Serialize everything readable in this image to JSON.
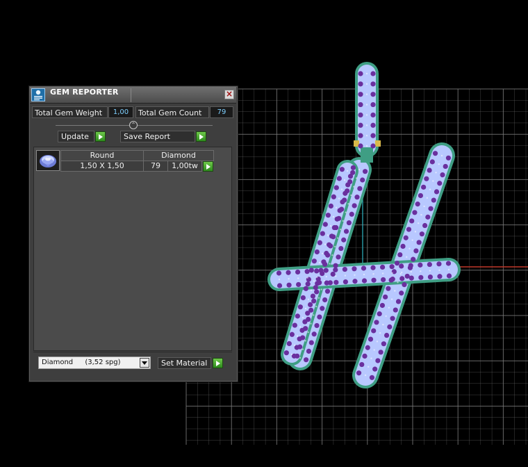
{
  "gem_reporter": {
    "title": "GEM REPORTER",
    "close_glyph": "×",
    "total_weight_label": "Total Gem Weight",
    "total_weight_value": "1,00",
    "total_count_label": "Total Gem Count",
    "total_count_value": "79",
    "slider_glyph": "⌃",
    "update_label": "Update",
    "save_report_label": "Save Report",
    "gem_table": {
      "headers": [
        "Round",
        "Diamond"
      ],
      "rows": [
        {
          "size": "1,50 X 1,50",
          "count": "79",
          "weight": "1,00tw"
        }
      ]
    },
    "material_select": {
      "value": "Diamond",
      "density": "(3,52 spg)"
    },
    "set_material_label": "Set Material"
  },
  "viewport": {
    "grid_color": "#7a7a7a",
    "background": "#000000",
    "model": {
      "shape": "letter-H-pendant",
      "metal_color": "#3f9e84",
      "stone_color": "#b8c8ff",
      "prong_color": "#6a2f9e",
      "bail_accent": "#d8b84a"
    },
    "axis_colors": {
      "x": "#c0392b",
      "y": "#2fb6c4"
    }
  },
  "icons": {
    "title": "gem-report-icon",
    "close": "close-icon",
    "update_go": "play-icon",
    "save_go": "play-icon",
    "material_go": "play-icon",
    "dropdown": "chevron-down-icon",
    "gem": "round-diamond-icon"
  }
}
